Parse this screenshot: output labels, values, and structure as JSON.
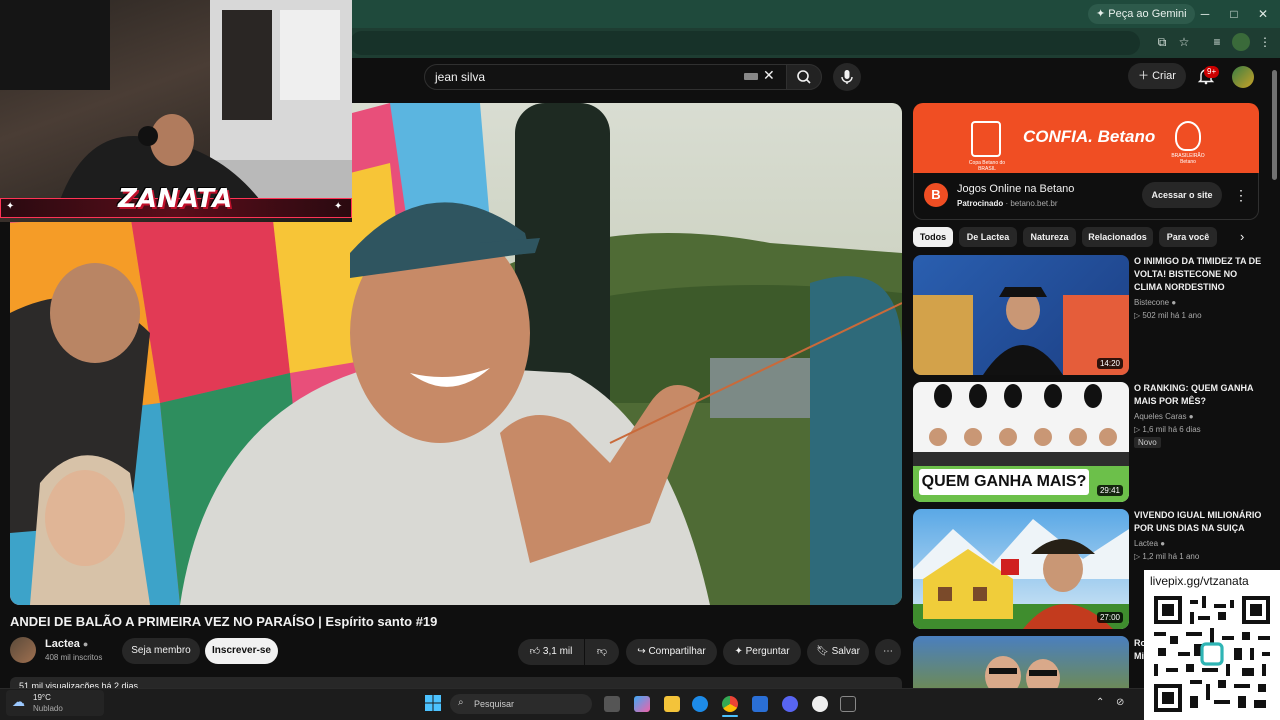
{
  "browser": {
    "gemini_label": "Peça ao Gemini",
    "controls": {
      "minimize": "─",
      "maximize": "□",
      "close": "✕"
    }
  },
  "header": {
    "search_value": "jean silva",
    "create_label": "Criar",
    "notifications": "9+"
  },
  "webcam": {
    "streamer_name": "ZANATA"
  },
  "video": {
    "title": "ANDEI DE BALÃO A PRIMEIRA VEZ NO PARAÍSO | Espírito santo #19",
    "channel": "Lactea",
    "subscribers": "408 mil inscritos",
    "member_label": "Seja membro",
    "subscribe_label": "Inscrever-se",
    "likes": "3,1 mil",
    "share_label": "Compartilhar",
    "ask_label": "Perguntar",
    "save_label": "Salvar",
    "views_line": "51 mil visualizações  há 2 dias"
  },
  "ad": {
    "banner_text": "CONFIA. Betano",
    "left_badge": "Copa Betano do BRASIL",
    "right_badge": "BRASILEIRÃO Betano",
    "title": "Jogos Online na Betano",
    "sponsored": "Patrocinado",
    "domain": "betano.bet.br",
    "cta": "Acessar o site"
  },
  "chips": [
    "Todos",
    "De Lactea",
    "Natureza",
    "Relacionados",
    "Para você"
  ],
  "recommendations": [
    {
      "title": "O INIMIGO DA TIMIDEZ TA DE VOLTA! BISTECONE NO CLIMA NORDESTINO",
      "channel": "Bistecone",
      "views": "502 mil",
      "age": "há 1 ano",
      "duration": "14:20",
      "badge": ""
    },
    {
      "title": "O RANKING: QUEM GANHA MAIS POR MÊS?",
      "channel": "Aqueles Caras",
      "views": "1,6 mil",
      "age": "há 6 dias",
      "duration": "29:41",
      "badge": "Novo",
      "thumb_text": "QUEM GANHA MAIS?"
    },
    {
      "title": "VIVENDO IGUAL MILIONÁRIO POR UNS DIAS NA SUIÇA",
      "channel": "Lactea",
      "views": "1,2 mil",
      "age": "há 1 ano",
      "duration": "27:00",
      "badge": ""
    },
    {
      "title": "Ro... Mi...",
      "channel": "",
      "views": "",
      "age": "",
      "duration": "",
      "badge": ""
    }
  ],
  "qr": {
    "url": "livepix.gg/vtzanata"
  },
  "taskbar": {
    "temperature": "19°C",
    "condition": "Nublado",
    "search_placeholder": "Pesquisar"
  },
  "colors": {
    "yt_bg": "#0f0f0f",
    "betano": "#f04e23",
    "chrome": "#1f4a3c"
  }
}
